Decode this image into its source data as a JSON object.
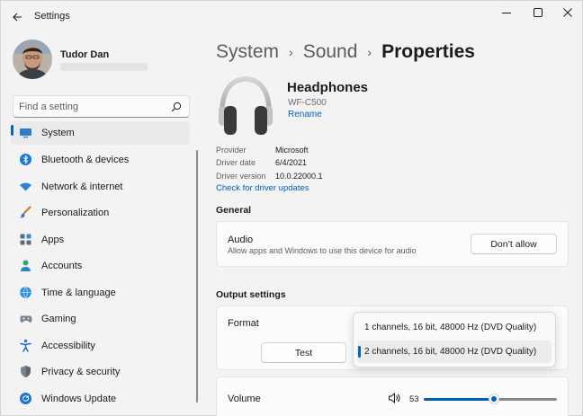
{
  "app": {
    "title": "Settings"
  },
  "user": {
    "name": "Tudor Dan"
  },
  "search": {
    "placeholder": "Find a setting"
  },
  "sidebar": {
    "items": [
      {
        "label": "System",
        "icon": "system-icon",
        "selected": true
      },
      {
        "label": "Bluetooth & devices",
        "icon": "bluetooth-icon"
      },
      {
        "label": "Network & internet",
        "icon": "wifi-icon"
      },
      {
        "label": "Personalization",
        "icon": "brush-icon"
      },
      {
        "label": "Apps",
        "icon": "apps-icon"
      },
      {
        "label": "Accounts",
        "icon": "accounts-icon"
      },
      {
        "label": "Time & language",
        "icon": "globe-clock-icon"
      },
      {
        "label": "Gaming",
        "icon": "gamepad-icon"
      },
      {
        "label": "Accessibility",
        "icon": "accessibility-icon"
      },
      {
        "label": "Privacy & security",
        "icon": "shield-icon"
      },
      {
        "label": "Windows Update",
        "icon": "update-icon"
      }
    ]
  },
  "breadcrumb": {
    "level1": "System",
    "level2": "Sound",
    "current": "Properties",
    "separator": "›"
  },
  "device": {
    "name": "Headphones",
    "model": "WF-C500",
    "rename_label": "Rename",
    "icon": "headphones-icon"
  },
  "properties": {
    "provider_label": "Provider",
    "provider_value": "Microsoft",
    "date_label": "Driver date",
    "date_value": "6/4/2021",
    "version_label": "Driver version",
    "version_value": "10.0.22000.1",
    "update_link": "Check for driver updates"
  },
  "general": {
    "title": "General",
    "audio_title": "Audio",
    "audio_desc": "Allow apps and Windows to use this device for audio",
    "dont_allow_label": "Don’t allow"
  },
  "output": {
    "title": "Output settings",
    "format_label": "Format",
    "test_label": "Test",
    "format_options": [
      {
        "label": "1 channels, 16 bit, 48000 Hz (DVD Quality)",
        "selected": false
      },
      {
        "label": "2 channels, 16 bit, 48000 Hz (DVD Quality)",
        "selected": true
      }
    ],
    "volume_label": "Volume",
    "volume_value": "53",
    "volume_level": 53
  },
  "colors": {
    "accent": "#005fb8",
    "selection_bar": "#0067c0"
  }
}
